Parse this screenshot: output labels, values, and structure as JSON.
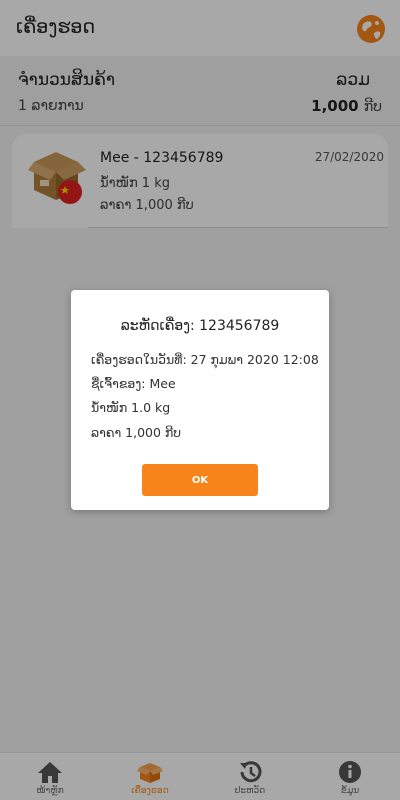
{
  "header": {
    "title": "ເຄື່ອງຮອດ",
    "globe_icon": "globe-icon",
    "accent": "#f7841b"
  },
  "summary": {
    "label": "ຈຳນວນສິນຄ້າ",
    "total_label": "ລວມ",
    "count_text": "1 ລາຍການ",
    "total_value": "1,000",
    "currency": "ກີບ"
  },
  "items": [
    {
      "title": "Mee - 123456789",
      "date": "27/02/2020",
      "weight": "ນ້ຳໜັກ 1 kg",
      "price": "ລາຄາ 1,000 ກີບ",
      "icon": "box-china-icon"
    }
  ],
  "dialog": {
    "title": "ລະຫັດເຄື່ອງ: 123456789",
    "arrived": "ເຄື່ອງຮອດໃນວັນທີ່: 27 ກຸມພາ 2020 12:08",
    "owner": "ຊື່ເຈົ້າຂອງ: Mee",
    "weight": "ນ້ຳໜັກ 1.0 kg",
    "price": "ລາຄາ 1,000 ກີບ",
    "ok": "OK"
  },
  "tabs": [
    {
      "label": "ໜ້າຫຼັກ",
      "icon": "home-icon",
      "active": false
    },
    {
      "label": "ເຄື່ອງຮອດ",
      "icon": "package-icon",
      "active": true
    },
    {
      "label": "ປະຫວັດ",
      "icon": "history-icon",
      "active": false
    },
    {
      "label": "ຂໍ້ມູນ",
      "icon": "info-icon",
      "active": false
    }
  ]
}
